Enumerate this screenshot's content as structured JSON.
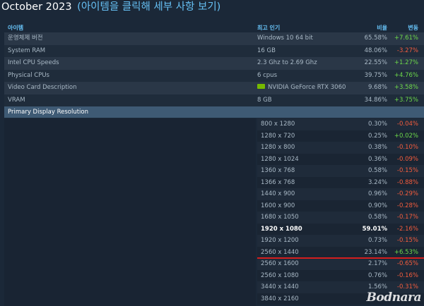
{
  "header": {
    "month": "October 2023",
    "subtitle": "(아이템을 클릭해 세부 사항 보기)"
  },
  "columns": {
    "item": "아이템",
    "popular": "최고 인기",
    "ratio": "비율",
    "change": "변동"
  },
  "rows": [
    {
      "name": "운영체제 버전",
      "popular": "Windows 10 64 bit",
      "pct": "65.58%",
      "change": "+7.61%"
    },
    {
      "name": "System RAM",
      "popular": "16 GB",
      "pct": "48.06%",
      "change": "-3.27%"
    },
    {
      "name": "Intel CPU Speeds",
      "popular": "2.3 Ghz to 2.69 Ghz",
      "pct": "22.55%",
      "change": "+1.27%"
    },
    {
      "name": "Physical CPUs",
      "popular": "6 cpus",
      "pct": "39.75%",
      "change": "+4.76%"
    },
    {
      "name": "Video Card Description",
      "popular": "NVIDIA GeForce RTX 3060",
      "pct": "9.68%",
      "change": "+3.58%",
      "icon": "nvidia-icon"
    },
    {
      "name": "VRAM",
      "popular": "8 GB",
      "pct": "34.86%",
      "change": "+3.75%"
    }
  ],
  "section": {
    "title": "Primary Display Resolution"
  },
  "resolutions": [
    {
      "name": "800 x 1280",
      "pct": "0.30%",
      "change": "-0.04%"
    },
    {
      "name": "1280 x 720",
      "pct": "0.25%",
      "change": "+0.02%"
    },
    {
      "name": "1280 x 800",
      "pct": "0.38%",
      "change": "-0.10%"
    },
    {
      "name": "1280 x 1024",
      "pct": "0.36%",
      "change": "-0.09%"
    },
    {
      "name": "1360 x 768",
      "pct": "0.58%",
      "change": "-0.15%"
    },
    {
      "name": "1366 x 768",
      "pct": "3.24%",
      "change": "-0.88%"
    },
    {
      "name": "1440 x 900",
      "pct": "0.96%",
      "change": "-0.29%"
    },
    {
      "name": "1600 x 900",
      "pct": "0.90%",
      "change": "-0.28%"
    },
    {
      "name": "1680 x 1050",
      "pct": "0.58%",
      "change": "-0.17%"
    },
    {
      "name": "1920 x 1080",
      "pct": "59.01%",
      "change": "-2.16%",
      "bold": true
    },
    {
      "name": "1920 x 1200",
      "pct": "0.73%",
      "change": "-0.15%"
    },
    {
      "name": "2560 x 1440",
      "pct": "23.14%",
      "change": "+6.53%"
    },
    {
      "name": "2560 x 1600",
      "pct": "2.17%",
      "change": "-0.65%"
    },
    {
      "name": "2560 x 1080",
      "pct": "0.76%",
      "change": "-0.16%"
    },
    {
      "name": "3440 x 1440",
      "pct": "1.56%",
      "change": "-0.31%"
    },
    {
      "name": "3840 x 2160",
      "pct": "",
      "change": ""
    }
  ],
  "colors": {
    "positive": "#6dd94a",
    "negative": "#f45c3d",
    "highlight_line": "#d41e1e"
  },
  "watermark": "Bodnara"
}
